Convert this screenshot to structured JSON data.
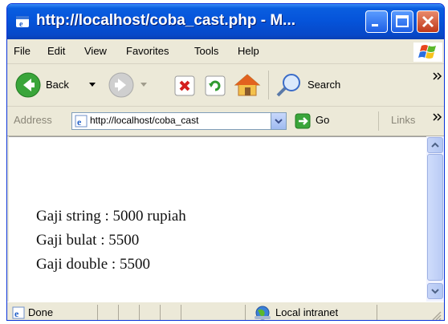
{
  "window": {
    "title": "http://localhost/coba_cast.php - M..."
  },
  "menu": [
    "File",
    "Edit",
    "View",
    "Favorites",
    "Tools",
    "Help"
  ],
  "toolbar": {
    "back_label": "Back",
    "search_label": "Search"
  },
  "address": {
    "label": "Address",
    "url": "http://localhost/coba_cast",
    "go_label": "Go",
    "links_label": "Links"
  },
  "content": {
    "lines": [
      "Gaji string : 5000 rupiah",
      "Gaji bulat : 5500",
      "Gaji double : 5500"
    ]
  },
  "status": {
    "text": "Done",
    "zone": "Local intranet"
  }
}
